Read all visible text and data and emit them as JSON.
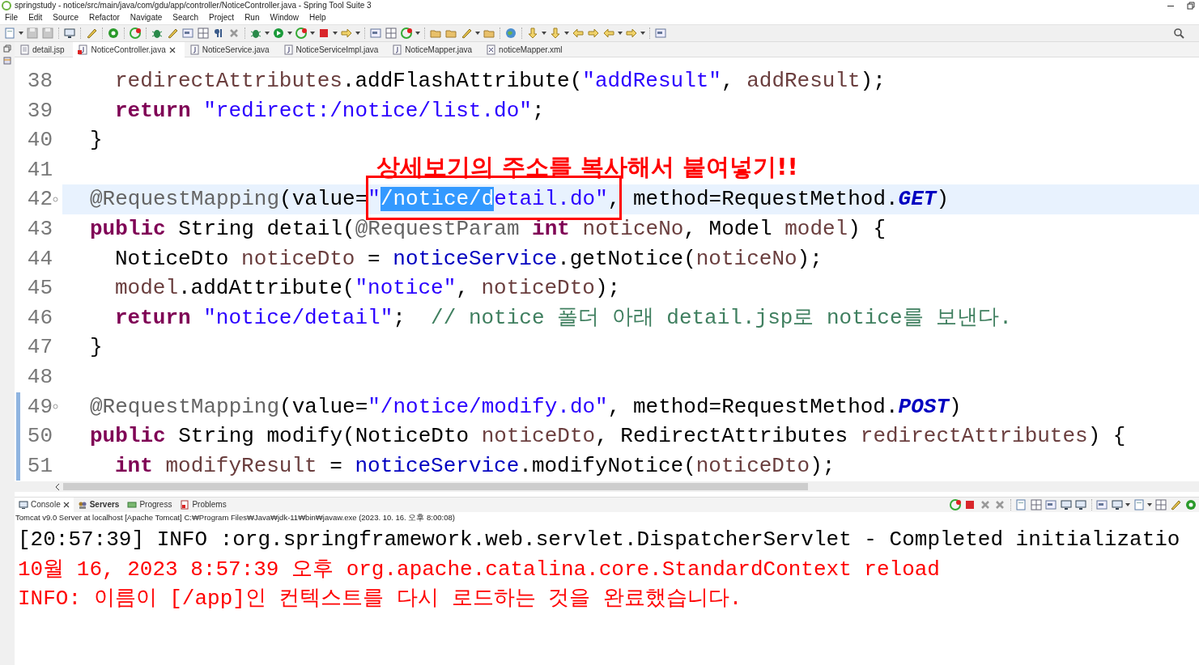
{
  "window": {
    "title": "springstudy - notice/src/main/java/com/gdu/app/controller/NoticeController.java - Spring Tool Suite 3"
  },
  "menu": [
    "File",
    "Edit",
    "Source",
    "Refactor",
    "Navigate",
    "Search",
    "Project",
    "Run",
    "Window",
    "Help"
  ],
  "editor_tabs": [
    {
      "label": "detail.jsp",
      "error": false,
      "selected": false
    },
    {
      "label": "NoticeController.java",
      "error": true,
      "selected": true
    },
    {
      "label": "NoticeService.java",
      "error": false,
      "selected": false
    },
    {
      "label": "NoticeServiceImpl.java",
      "error": false,
      "selected": false
    },
    {
      "label": "NoticeMapper.java",
      "error": false,
      "selected": false
    },
    {
      "label": "noticeMapper.xml",
      "error": false,
      "selected": false
    }
  ],
  "lines": [
    {
      "number": "38",
      "indent": true,
      "current": false,
      "fold": false,
      "changed": false,
      "tokens": [
        {
          "kind": "var",
          "text": "redirectAttributes"
        },
        {
          "kind": "plain",
          "text": ".addFlashAttribute("
        },
        {
          "kind": "string",
          "text": "\"addResult\""
        },
        {
          "kind": "plain",
          "text": ", "
        },
        {
          "kind": "var",
          "text": "addResult"
        },
        {
          "kind": "plain",
          "text": ");"
        }
      ]
    },
    {
      "number": "39",
      "indent": true,
      "current": false,
      "fold": false,
      "changed": false,
      "tokens": [
        {
          "kind": "keyword",
          "text": "return "
        },
        {
          "kind": "string",
          "text": "\"redirect:/notice/list.do\""
        },
        {
          "kind": "plain",
          "text": ";"
        }
      ]
    },
    {
      "number": "40",
      "indent": false,
      "current": false,
      "fold": false,
      "changed": false,
      "tokens": [
        {
          "kind": "plain",
          "text": "}"
        }
      ]
    },
    {
      "number": "41",
      "current": false,
      "fold": false,
      "changed": false
    },
    {
      "number": "42",
      "indent": false,
      "current": true,
      "fold": true,
      "changed": false,
      "tokens": [
        {
          "kind": "annotation",
          "text": "@RequestMapping"
        },
        {
          "kind": "plain",
          "text": "(value="
        },
        {
          "kind": "string",
          "text": "\""
        },
        {
          "kind": "string_selected",
          "text": "/notice/d"
        },
        {
          "kind": "string",
          "text": "etail.do\""
        },
        {
          "kind": "plain",
          "text": ", method=RequestMethod."
        },
        {
          "kind": "constant",
          "text": "GET"
        },
        {
          "kind": "plain",
          "text": ")"
        }
      ]
    },
    {
      "number": "43",
      "indent": false,
      "current": false,
      "fold": false,
      "changed": false,
      "tokens": [
        {
          "kind": "keyword",
          "text": "public"
        },
        {
          "kind": "plain",
          "text": " String detail("
        },
        {
          "kind": "annotation",
          "text": "@RequestParam "
        },
        {
          "kind": "keyword",
          "text": "int "
        },
        {
          "kind": "var",
          "text": "noticeNo"
        },
        {
          "kind": "plain",
          "text": ", Model "
        },
        {
          "kind": "var",
          "text": "model"
        },
        {
          "kind": "plain",
          "text": ") {"
        }
      ]
    },
    {
      "number": "44",
      "indent": true,
      "current": false,
      "fold": false,
      "changed": false,
      "tokens": [
        {
          "kind": "plain",
          "text": "NoticeDto "
        },
        {
          "kind": "var",
          "text": "noticeDto"
        },
        {
          "kind": "plain",
          "text": " = "
        },
        {
          "kind": "field",
          "text": "noticeService"
        },
        {
          "kind": "plain",
          "text": ".getNotice("
        },
        {
          "kind": "var",
          "text": "noticeNo"
        },
        {
          "kind": "plain",
          "text": ");"
        }
      ]
    },
    {
      "number": "45",
      "indent": true,
      "current": false,
      "fold": false,
      "changed": false,
      "tokens": [
        {
          "kind": "var",
          "text": "model"
        },
        {
          "kind": "plain",
          "text": ".addAttribute("
        },
        {
          "kind": "string",
          "text": "\"notice\""
        },
        {
          "kind": "plain",
          "text": ", "
        },
        {
          "kind": "var",
          "text": "noticeDto"
        },
        {
          "kind": "plain",
          "text": ");"
        }
      ]
    },
    {
      "number": "46",
      "indent": true,
      "current": false,
      "fold": false,
      "changed": false,
      "tokens": [
        {
          "kind": "keyword",
          "text": "return "
        },
        {
          "kind": "string",
          "text": "\"notice/detail\""
        },
        {
          "kind": "plain",
          "text": ";  "
        },
        {
          "kind": "comment",
          "text": "// notice 폴더 아래 detail.jsp로 notice를 보낸다."
        }
      ]
    },
    {
      "number": "47",
      "indent": false,
      "current": false,
      "fold": false,
      "changed": false,
      "tokens": [
        {
          "kind": "plain",
          "text": "}"
        }
      ]
    },
    {
      "number": "48",
      "current": false,
      "fold": false,
      "changed": false
    },
    {
      "number": "49",
      "indent": false,
      "current": false,
      "fold": true,
      "changed": true,
      "tokens": [
        {
          "kind": "annotation",
          "text": "@RequestMapping"
        },
        {
          "kind": "plain",
          "text": "(value="
        },
        {
          "kind": "string",
          "text": "\"/notice/modify.do\""
        },
        {
          "kind": "plain",
          "text": ", method=RequestMethod."
        },
        {
          "kind": "constant",
          "text": "POST"
        },
        {
          "kind": "plain",
          "text": ")"
        }
      ]
    },
    {
      "number": "50",
      "indent": false,
      "current": false,
      "fold": false,
      "changed": true,
      "tokens": [
        {
          "kind": "keyword",
          "text": "public"
        },
        {
          "kind": "plain",
          "text": " String modify(NoticeDto "
        },
        {
          "kind": "var",
          "text": "noticeDto"
        },
        {
          "kind": "plain",
          "text": ", RedirectAttributes "
        },
        {
          "kind": "var",
          "text": "redirectAttributes"
        },
        {
          "kind": "plain",
          "text": ") {"
        }
      ]
    },
    {
      "number": "51",
      "indent": true,
      "current": false,
      "fold": false,
      "changed": true,
      "tokens": [
        {
          "kind": "keyword",
          "text": "int "
        },
        {
          "kind": "var",
          "text": "modifyResult"
        },
        {
          "kind": "plain",
          "text": " = "
        },
        {
          "kind": "field",
          "text": "noticeService"
        },
        {
          "kind": "plain",
          "text": ".modifyNotice("
        },
        {
          "kind": "var",
          "text": "noticeDto"
        },
        {
          "kind": "plain",
          "text": ");"
        }
      ]
    }
  ],
  "overlay_note": {
    "text": "상세보기의 주소를 복사해서 붙여넣기!!"
  },
  "console_tabs": [
    {
      "label": "Console",
      "selected": true,
      "bold": false
    },
    {
      "label": "Servers",
      "selected": false,
      "bold": true
    },
    {
      "label": "Progress",
      "selected": false,
      "bold": false
    },
    {
      "label": "Problems",
      "selected": false,
      "bold": false
    }
  ],
  "console_description": "Tomcat v9.0 Server at localhost [Apache Tomcat] C:₩Program Files₩Java₩jdk-11₩bin₩javaw.exe  (2023. 10. 16. 오후 8:00:08)",
  "console_lines": [
    {
      "kind": "stdout",
      "text": "[20:57:39] INFO :org.springframework.web.servlet.DispatcherServlet - Completed initializatio"
    },
    {
      "kind": "stderr",
      "text": "10월 16, 2023 8:57:39 오후 org.apache.catalina.core.StandardContext reload"
    },
    {
      "kind": "stderr",
      "text": "INFO: 이름이 [/app]인 컨텍스트를 다시 로드하는 것을 완료했습니다."
    }
  ]
}
